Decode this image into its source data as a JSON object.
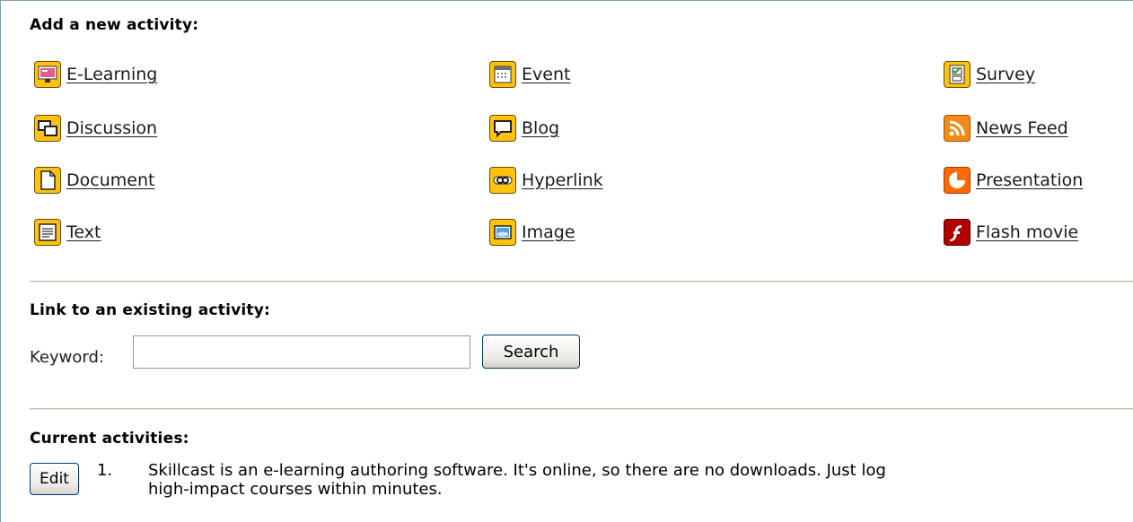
{
  "add_section": {
    "title": "Add a new activity:",
    "activities": [
      {
        "label": "E-Learning",
        "icon": "elearning-icon"
      },
      {
        "label": "Event",
        "icon": "calendar-icon"
      },
      {
        "label": "Survey",
        "icon": "survey-icon"
      },
      {
        "label": "Discussion",
        "icon": "discussion-icon"
      },
      {
        "label": "Blog",
        "icon": "blog-icon"
      },
      {
        "label": "News Feed",
        "icon": "rss-icon"
      },
      {
        "label": "Document",
        "icon": "document-icon"
      },
      {
        "label": "Hyperlink",
        "icon": "hyperlink-icon"
      },
      {
        "label": "Presentation",
        "icon": "presentation-icon"
      },
      {
        "label": "Text",
        "icon": "text-icon"
      },
      {
        "label": "Image",
        "icon": "image-icon"
      },
      {
        "label": "Flash movie",
        "icon": "flash-icon"
      }
    ]
  },
  "link_section": {
    "title": "Link to an existing activity:",
    "keyword_label": "Keyword:",
    "keyword_value": "",
    "keyword_placeholder": "",
    "search_label": "Search"
  },
  "current_section": {
    "title": "Current activities:",
    "items": [
      {
        "edit_label": "Edit",
        "number": "1.",
        "line1": "Skillcast is an e-learning authoring software. It's online, so there are no downloads. Just log",
        "line2": "high-impact courses within minutes."
      }
    ]
  },
  "colors": {
    "icon_yellow": "#ffc20e",
    "rss_orange": "#f28a16",
    "presentation_orange": "#ff6a00",
    "flash_red": "#b30000",
    "divider": "#bfbfaa",
    "frame_border": "#7f9db9"
  }
}
